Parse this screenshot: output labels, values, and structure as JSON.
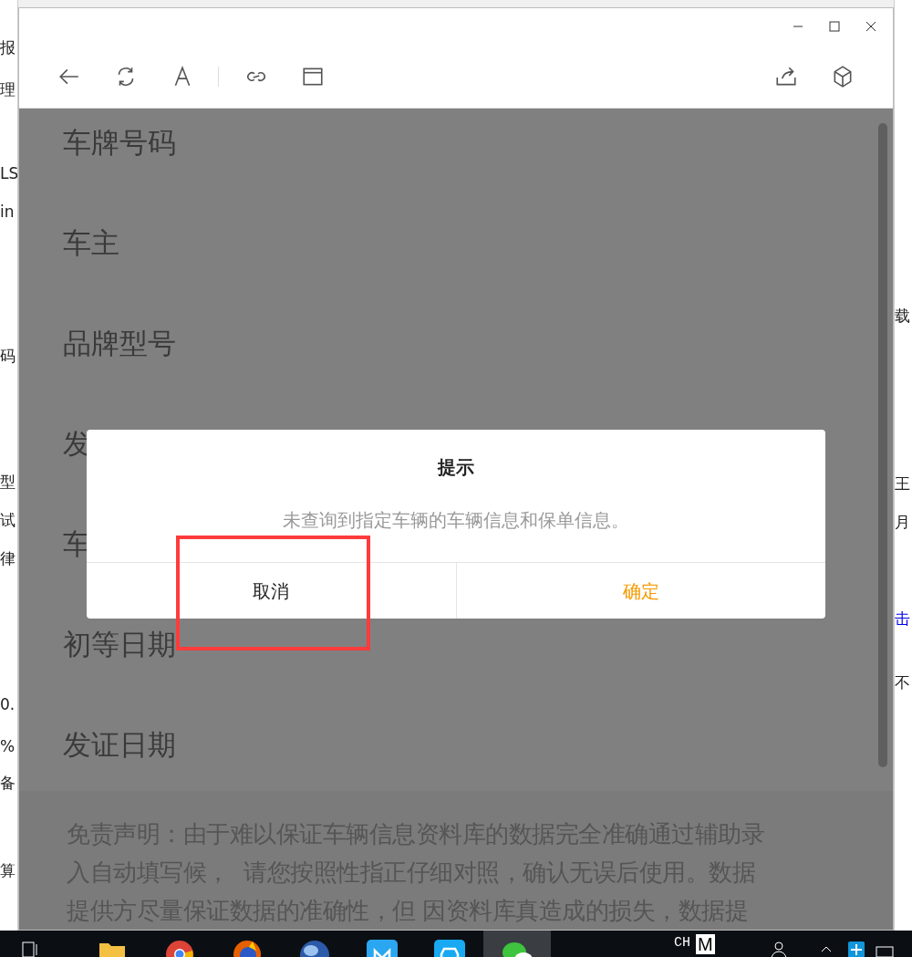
{
  "background_app": {
    "left_fragments": [
      "报",
      "理",
      "LS",
      "in",
      "码",
      "型",
      "试",
      "律",
      "0.",
      "%",
      "备",
      "算"
    ],
    "right_fragments": [
      "载",
      "王",
      "月",
      "击",
      "不"
    ]
  },
  "form": {
    "fields": [
      "车牌号码",
      "车主",
      "品牌型号",
      "发",
      "车",
      "初等日期",
      "发证日期"
    ]
  },
  "disclaimer_lines": [
    "免责声明：由于难以保证车辆信息资料库的数据完全准确通过辅助录",
    "入自动填写候，  请您按照性指正仔细对照，确认无误后使用。数据",
    "提供方尽量保证数据的准确性，但 因资料库真造成的损失，数据提"
  ],
  "dialog": {
    "title": "提示",
    "message": "未查询到指定车辆的车辆信息和保单信息。",
    "buttons": [
      {
        "label": "取消",
        "kind": "cancel"
      },
      {
        "label": "确定",
        "kind": "confirm"
      }
    ]
  },
  "taskbar": {
    "apps": [
      {
        "kind": "folder",
        "selected": false
      },
      {
        "kind": "chrome",
        "selected": false
      },
      {
        "kind": "firefox",
        "selected": false
      },
      {
        "kind": "globe",
        "selected": false
      },
      {
        "kind": "blue",
        "selected": false
      },
      {
        "kind": "car",
        "selected": false
      },
      {
        "kind": "wechat",
        "selected": true
      }
    ],
    "ime": "CH",
    "ime_mode": "M"
  }
}
